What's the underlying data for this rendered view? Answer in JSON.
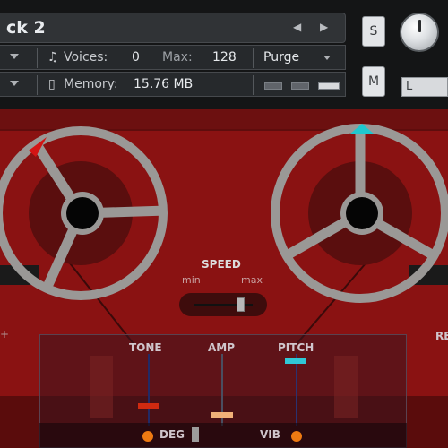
{
  "header": {
    "title": "ck 2",
    "voices_label": "Voices:",
    "voices_value": "0",
    "max_label": "Max:",
    "max_value": "128",
    "memory_label": "Memory:",
    "memory_value": "15.76 MB",
    "purge_label": "Purge",
    "solo_label": "S",
    "mute_label": "M",
    "pan_label": "L",
    "prev_icon": "triangle-left",
    "next_icon": "triangle-right",
    "midi_icon": "note-icon",
    "memory_icon": "memory-icon"
  },
  "controls": {
    "speed_label": "SPEED",
    "speed_min": "min",
    "speed_max": "max",
    "speed_level": 0.85,
    "tone_label": "TONE",
    "amp_label": "AMP",
    "pitch_label": "PITCH",
    "rev_label": "RE",
    "deg_label": "DEG",
    "vib_label": "VIB",
    "plus_glyph": "+"
  },
  "colors": {
    "body": "#8a1212",
    "reel": "#9a9896",
    "left_marker": "#d41414",
    "right_marker": "#1fc7cf",
    "tone_thumb": "#d02a10",
    "amp_thumb": "#f0b078",
    "pitch_thumb": "#30c8d6",
    "dot": "#ee7a12"
  }
}
